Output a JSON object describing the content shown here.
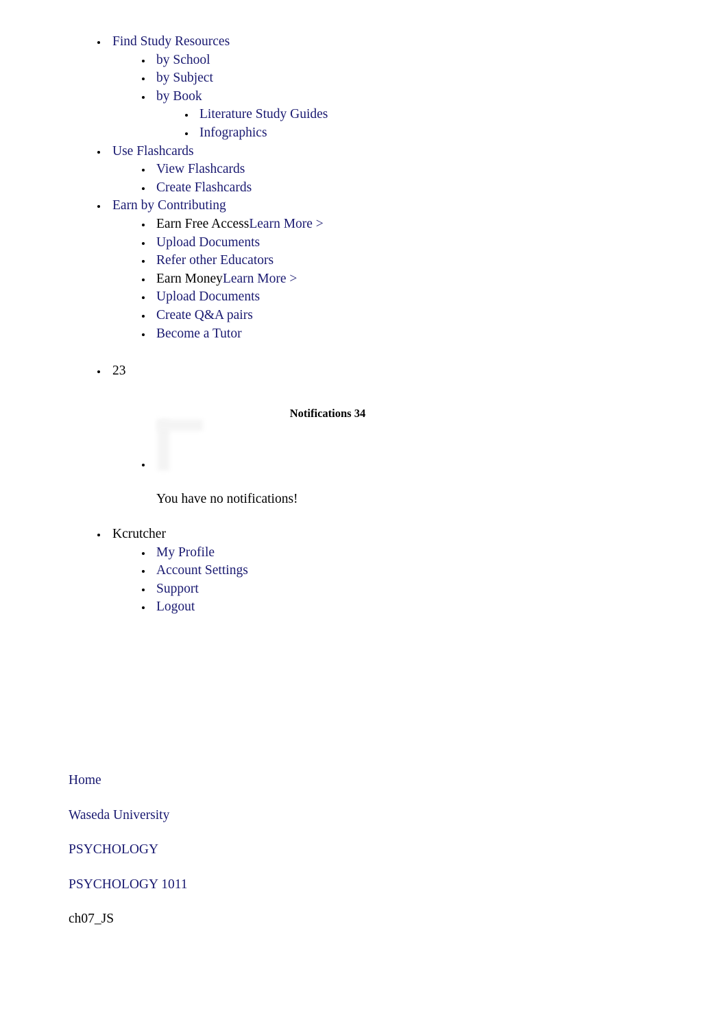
{
  "colors": {
    "link": "#191970",
    "text": "#000000",
    "background": "#ffffff",
    "placeholder_gray": "#f4f4f4"
  },
  "nav": {
    "items": [
      {
        "label": "Find Study Resources",
        "type": "link",
        "children": [
          {
            "label": "by School",
            "type": "link"
          },
          {
            "label": "by Subject",
            "type": "link"
          },
          {
            "label": "by Book",
            "type": "link",
            "children": [
              {
                "label": "Literature Study Guides",
                "type": "link"
              },
              {
                "label": "Infographics",
                "type": "link"
              }
            ]
          }
        ]
      },
      {
        "label": "Use Flashcards",
        "type": "link",
        "children": [
          {
            "label": "View Flashcards",
            "type": "link"
          },
          {
            "label": "Create Flashcards",
            "type": "link"
          }
        ]
      },
      {
        "label": "Earn by Contributing",
        "type": "link",
        "children": [
          {
            "label": "Earn Free Access",
            "type": "text",
            "suffix_link": "Learn More >"
          },
          {
            "label": "Upload Documents",
            "type": "link"
          },
          {
            "label": "Refer other Educators",
            "type": "link"
          },
          {
            "label": "Earn Money",
            "type": "text",
            "suffix_link": "Learn More >"
          },
          {
            "label": "Upload Documents",
            "type": "link"
          },
          {
            "label": "Create Q&A pairs",
            "type": "link"
          },
          {
            "label": "Become a Tutor",
            "type": "link"
          }
        ]
      }
    ]
  },
  "badge": {
    "count": "23"
  },
  "notifications": {
    "heading_label": "Notifications",
    "heading_count": "34",
    "heading_full": "Notifications 34",
    "empty_message": "You have no notifications!"
  },
  "user_menu": {
    "username": "Kcrutcher",
    "items": [
      {
        "label": "My Profile"
      },
      {
        "label": "Account Settings"
      },
      {
        "label": "Support"
      },
      {
        "label": "Logout"
      }
    ]
  },
  "breadcrumb": {
    "items": [
      {
        "label": "Home",
        "type": "link"
      },
      {
        "label": "Waseda University",
        "type": "link"
      },
      {
        "label": "PSYCHOLOGY",
        "type": "link"
      },
      {
        "label": "PSYCHOLOGY 1011",
        "type": "link"
      },
      {
        "label": "ch07_JS",
        "type": "text"
      }
    ]
  }
}
